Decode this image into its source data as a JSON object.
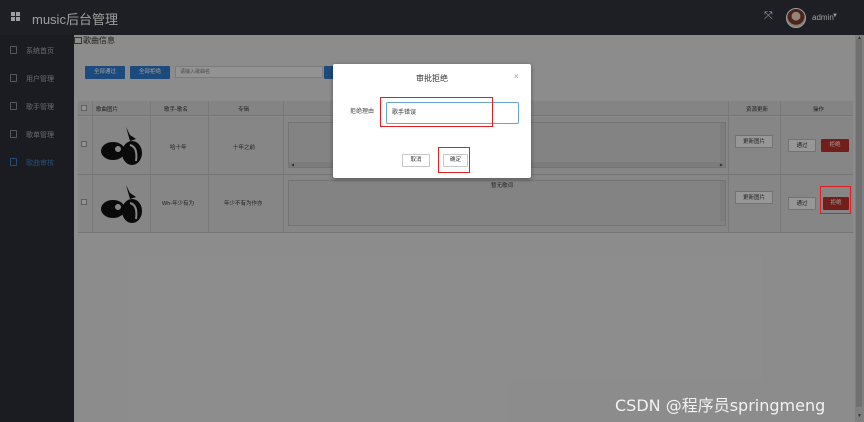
{
  "app": {
    "title": "music后台管理"
  },
  "header": {
    "user_name": "admin"
  },
  "sidebar": {
    "items": [
      {
        "label": "系统首页",
        "active": false
      },
      {
        "label": "用户管理",
        "active": false
      },
      {
        "label": "歌手管理",
        "active": false
      },
      {
        "label": "歌单管理",
        "active": false
      },
      {
        "label": "歌曲审核",
        "active": true
      }
    ]
  },
  "page": {
    "breadcrumb": "歌曲信息"
  },
  "toolbar": {
    "approve_all_label": "全部通过",
    "reject_all_label": "全部拒绝",
    "search_placeholder": "请输入歌曲名"
  },
  "table": {
    "columns": [
      "歌曲图片",
      "歌手-歌名",
      "专辑",
      "资源更新",
      "操作"
    ],
    "rows": [
      {
        "singer_song": "哈十年",
        "album": "十年之前",
        "lyric": "",
        "update_label": "更新图片",
        "approve_label": "通过",
        "reject_label": "拒绝"
      },
      {
        "singer_song": "Wh-年少有为",
        "album": "年少不有为作亦",
        "lyric": "暂无歌词",
        "update_label": "更新图片",
        "approve_label": "通过",
        "reject_label": "拒绝"
      }
    ]
  },
  "modal": {
    "title": "审批拒绝",
    "label": "拒绝理由",
    "reason_value": "歌手错误",
    "cancel_label": "取消",
    "confirm_label": "确定"
  },
  "watermark": "CSDN @程序员springmeng",
  "colors": {
    "primary": "#2f78c8",
    "danger": "#b8332e",
    "highlight": "#e02020",
    "topbar": "#2f323a",
    "sidebar": "#2b2e36"
  }
}
